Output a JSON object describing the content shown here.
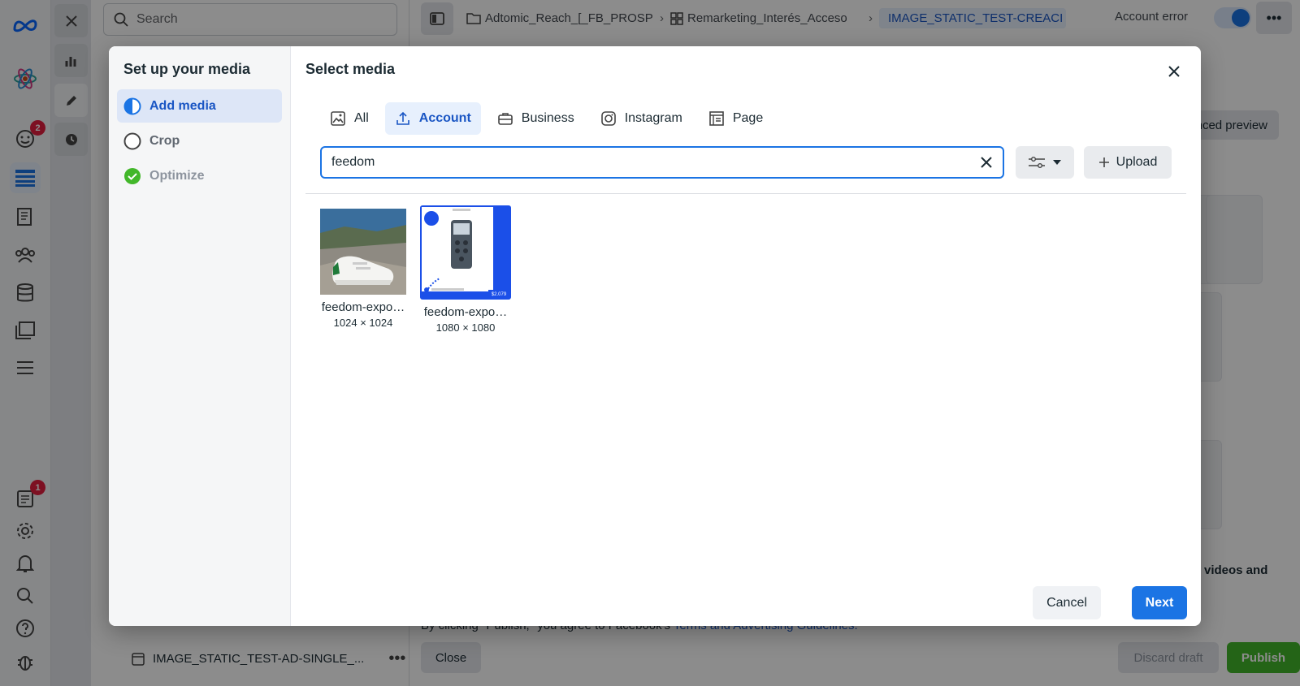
{
  "colors": {
    "accent": "#1b74e4",
    "badge": "#e41e3f",
    "success": "#42b72a"
  },
  "rail": {
    "notifications_badge": "2",
    "reports_badge": "1",
    "icons": [
      "meta-logo-icon",
      "atom-icon",
      "emoji-icon",
      "table-icon",
      "pages-icon",
      "people-icon",
      "database-icon",
      "gallery-icon",
      "menu-icon",
      "reports-icon",
      "gear-icon",
      "bell-icon",
      "search-icon",
      "help-icon",
      "bug-icon"
    ]
  },
  "leftpane": {
    "search_placeholder": "Search",
    "bottom_item": "IMAGE_STATIC_TEST-AD-SINGLE_..."
  },
  "topbar": {
    "crumbs": [
      "Adtomic_Reach_[_FB_PROSP",
      "Remarketing_Interés_Acceso",
      "IMAGE_STATIC_TEST-CREACI"
    ],
    "account_error": "Account error"
  },
  "background": {
    "advanced_preview": "nced preview",
    "videos_text": "videos and",
    "terms_prefix": "By clicking \"Publish,\" you agree to Facebook's ",
    "terms_link": "Terms and Advertising Guidelines.",
    "close_label": "Close",
    "discard_label": "Discard draft",
    "publish_label": "Publish"
  },
  "steps": {
    "title": "Set up your media",
    "items": [
      {
        "label": "Add media",
        "state": "active"
      },
      {
        "label": "Crop",
        "state": "pending"
      },
      {
        "label": "Optimize",
        "state": "done"
      }
    ]
  },
  "modal": {
    "title": "Select media",
    "tabs": [
      {
        "label": "All",
        "icon": "image-icon"
      },
      {
        "label": "Account",
        "icon": "upload-icon"
      },
      {
        "label": "Business",
        "icon": "briefcase-icon"
      },
      {
        "label": "Instagram",
        "icon": "instagram-icon"
      },
      {
        "label": "Page",
        "icon": "page-icon"
      }
    ],
    "active_tab": "Account",
    "search_value": "feedom",
    "upload_label": "Upload",
    "media": [
      {
        "name": "feedom-expo…",
        "dims": "1024 × 1024",
        "thumb": "sneaker-on-rock"
      },
      {
        "name": "feedom-expo…",
        "dims": "1080 × 1080",
        "thumb": "device-product-ad",
        "thumb_text": "$2.079"
      }
    ],
    "cancel_label": "Cancel",
    "next_label": "Next"
  }
}
